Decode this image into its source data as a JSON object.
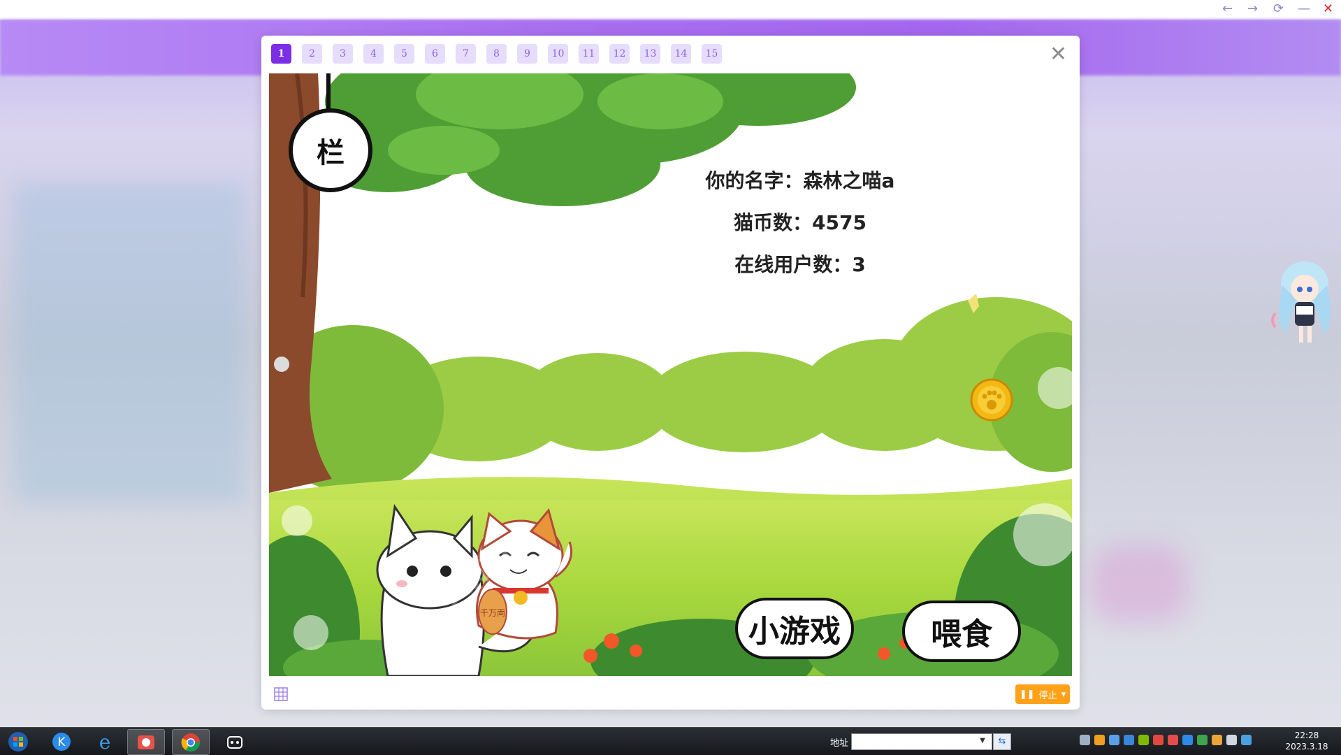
{
  "browser": {
    "back_icon": "←",
    "forward_icon": "→",
    "refresh_icon": "⟳",
    "minimize_icon": "—",
    "close_icon": "✕"
  },
  "tabs": [
    "1",
    "2",
    "3",
    "4",
    "5",
    "6",
    "7",
    "8",
    "9",
    "10",
    "11",
    "12",
    "13",
    "14",
    "15"
  ],
  "active_tab": "1",
  "modal_close_icon": "✕",
  "scene": {
    "badge_text": "栏",
    "name_line": "你的名字：森林之喵a",
    "coins_line": "猫币数：4575",
    "online_line": "在线用户数：3",
    "minigame_button": "小游戏",
    "feed_button": "喂食",
    "lucky_cat_coin_text": "千万両"
  },
  "footer": {
    "stop_label": "停止",
    "stop_icon": "❚❚",
    "dropdown_icon": "▾"
  },
  "taskbar": {
    "address_label": "地址",
    "address_value": "",
    "go_icon": "⇆",
    "time": "22:28",
    "date": "2023.3.18"
  },
  "colors": {
    "accent": "#7c2ee6",
    "tab_bg": "#e6dcfb",
    "stop_button": "#ffa21a",
    "grass": "#9fd43a"
  }
}
